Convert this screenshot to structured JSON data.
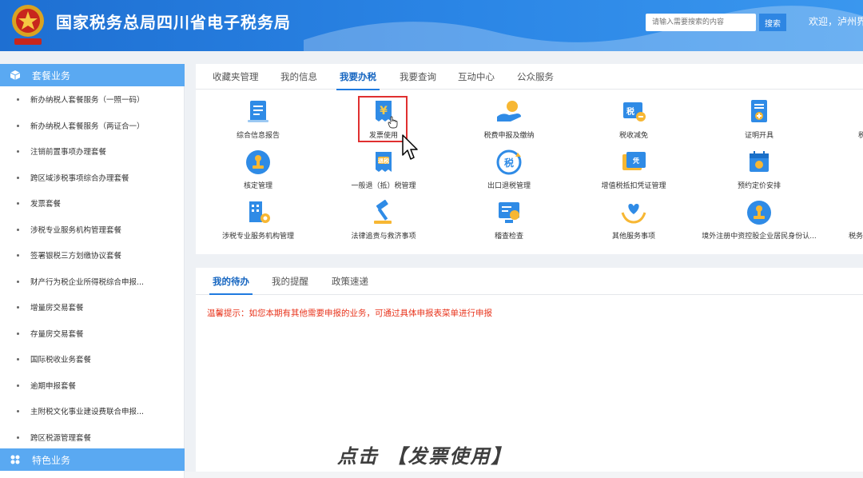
{
  "header": {
    "title": "国家税务总局四川省电子税务局",
    "search_placeholder": "请输入需要搜索的内容",
    "search_label": "搜索",
    "welcome": "欢迎，泸州界"
  },
  "sidebar": {
    "section1_label": "套餐业务",
    "items": [
      "新办纳税人套餐服务（一照一码）",
      "新办纳税人套餐服务（两证合一）",
      "注销前置事项办理套餐",
      "跨区域涉税事项综合办理套餐",
      "发票套餐",
      "涉税专业服务机构管理套餐",
      "签署银税三方划缴协议套餐",
      "财产行为税企业所得税综合申报...",
      "增量房交易套餐",
      "存量房交易套餐",
      "国际税收业务套餐",
      "逾期申报套餐",
      "主附税文化事业建设费联合申报...",
      "跨区税源管理套餐"
    ],
    "section2_label": "特色业务"
  },
  "top_tabs": [
    "收藏夹管理",
    "我的信息",
    "我要办税",
    "我要查询",
    "互动中心",
    "公众服务"
  ],
  "active_top_tab": "我要办税",
  "services": {
    "row1": [
      "综合信息报告",
      "发票使用",
      "税费申报及缴纳",
      "税收减免",
      "证明开具",
      "税"
    ],
    "row2": [
      "核定管理",
      "一般退（抵）税管理",
      "出口退税管理",
      "增值税抵扣凭证管理",
      "预约定价安排"
    ],
    "row3": [
      "涉税专业服务机构管理",
      "法律追责与救济事项",
      "稽查检查",
      "其他服务事项",
      "境外注册中资控股企业居民身份认...",
      "税务"
    ]
  },
  "icon_names": {
    "row1": [
      "report-icon",
      "invoice-icon",
      "declare-pay-icon",
      "tax-reduction-icon",
      "certificate-icon"
    ],
    "row2": [
      "verify-icon",
      "refund-icon",
      "export-refund-icon",
      "vat-deduction-icon",
      "pricing-calendar-icon"
    ],
    "row3": [
      "agency-building-icon",
      "gavel-icon",
      "inspection-icon",
      "heart-hand-icon",
      "resident-identity-icon"
    ]
  },
  "bottom_tabs": [
    "我的待办",
    "我的提醒",
    "政策速递"
  ],
  "active_bottom_tab": "我的待办",
  "notice": "温馨提示：如您本期有其他需要申报的业务，可通过具体申报表菜单进行申报",
  "caption": "点击 【发票使用】",
  "colors": {
    "header_blue": "#2b86e6",
    "sidebar_head": "#5aa9f2",
    "accent": "#1f7ae0",
    "notice_red": "#e8341c",
    "highlight_red": "#e03030"
  }
}
